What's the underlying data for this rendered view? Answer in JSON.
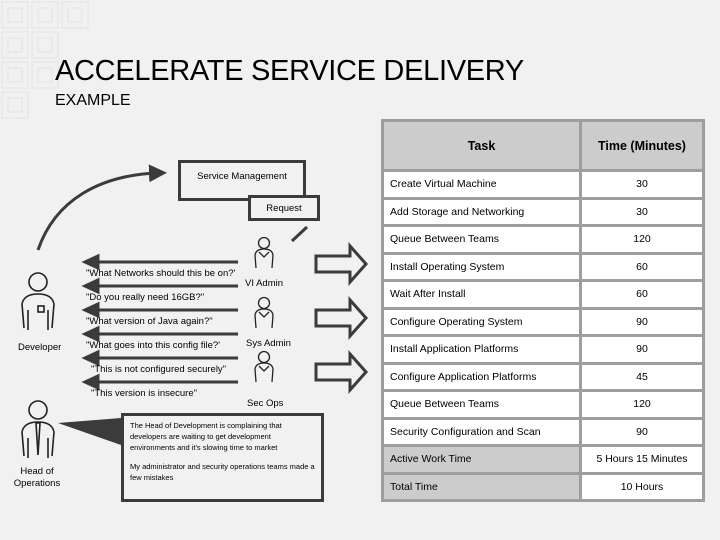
{
  "header": {
    "title": "ACCELERATE SERVICE DELIVERY",
    "subtitle": "EXAMPLE"
  },
  "diagram": {
    "service_management": "Service Management",
    "request": "Request",
    "roles": {
      "developer": "Developer",
      "head_of_operations": "Head of Operations",
      "vi_admin": "VI Admin",
      "sys_admin": "Sys Admin",
      "sec_ops": "Sec Ops"
    },
    "quotes": [
      "\"What Networks should this be on?'",
      "\"Do you really need 16GB?\"",
      "\"What version of Java again?\"",
      "\"What goes into this config file?'",
      "\"This is not configured securely\"",
      "\"This version is insecure\""
    ],
    "note": {
      "paragraph1": "The Head of Development is complaining that developers are waiting to get development environments and it's slowing time to market",
      "paragraph2": "My administrator and security operations teams made a few mistakes"
    }
  },
  "table": {
    "headers": [
      "Task",
      "Time (Minutes)"
    ],
    "rows": [
      {
        "task": "Create Virtual Machine",
        "time": "30"
      },
      {
        "task": "Add Storage and Networking",
        "time": "30"
      },
      {
        "task": "Queue Between Teams",
        "time": "120"
      },
      {
        "task": "Install Operating System",
        "time": "60"
      },
      {
        "task": "Wait After Install",
        "time": "60"
      },
      {
        "task": "Configure Operating System",
        "time": "90"
      },
      {
        "task": "Install Application Platforms",
        "time": "90"
      },
      {
        "task": "Configure Application Platforms",
        "time": "45"
      },
      {
        "task": "Queue Between Teams",
        "time": "120"
      },
      {
        "task": "Security Configuration and Scan",
        "time": "90"
      }
    ],
    "summary": [
      {
        "label": "Active Work Time",
        "value": "5 Hours 15 Minutes"
      },
      {
        "label": "Total Time",
        "value": "10 Hours"
      }
    ]
  },
  "colors": {
    "background": "#f1f1f1",
    "table_border": "#9e9e9e",
    "table_header": "#cccccc",
    "stroke": "#3b3b3b"
  }
}
